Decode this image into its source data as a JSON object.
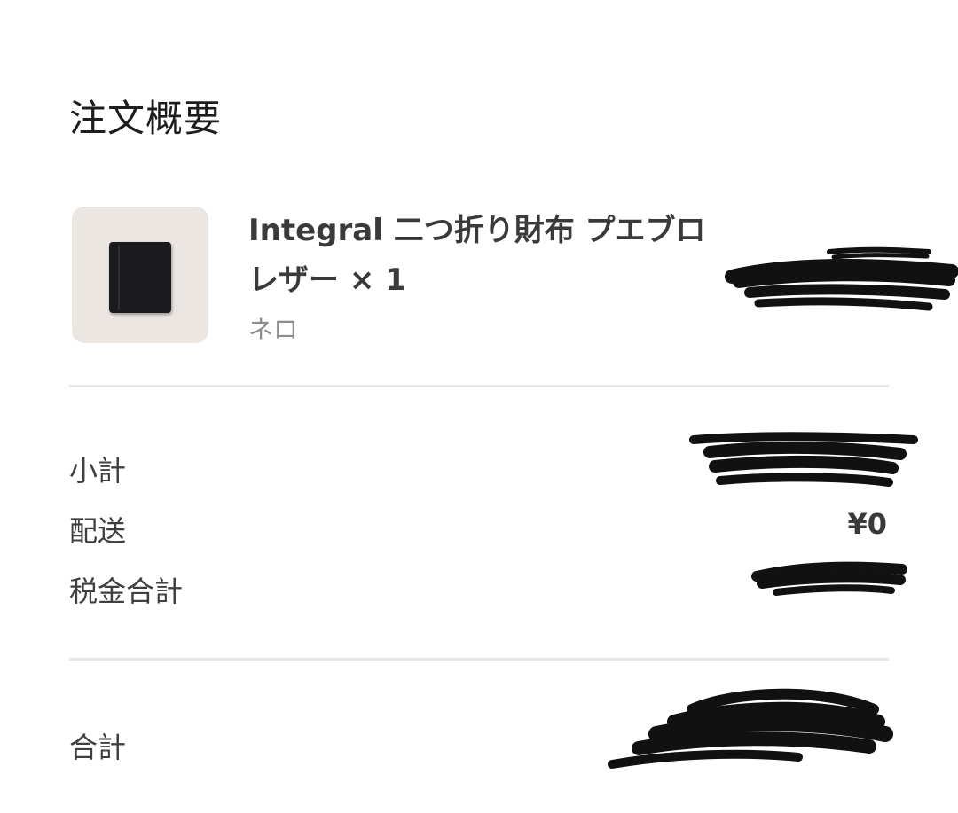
{
  "order_summary": {
    "title": "注文概要",
    "item": {
      "name": "Integral 二つ折り財布 プエブロレザー × 1",
      "variant": "ネロ"
    },
    "rows": [
      {
        "label": "小計"
      },
      {
        "label": "配送",
        "value": "¥0"
      },
      {
        "label": "税金合計"
      }
    ],
    "total": {
      "label": "合計"
    }
  }
}
